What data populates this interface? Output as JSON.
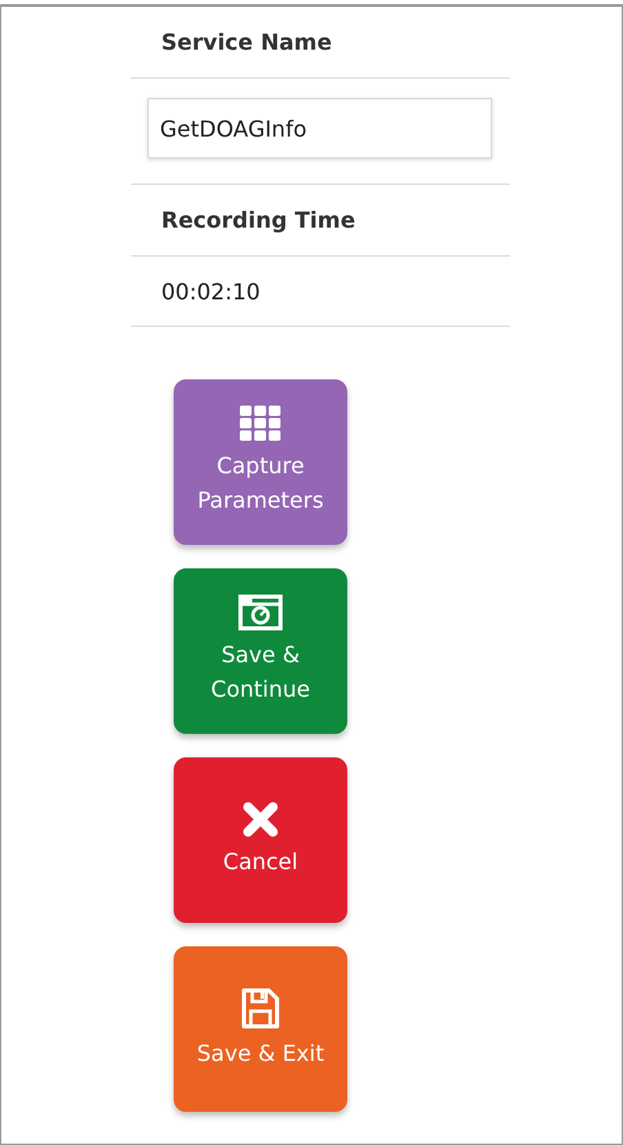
{
  "service_name": {
    "label": "Service Name",
    "value": "GetDOAGInfo"
  },
  "recording_time": {
    "label": "Recording Time",
    "value": "00:02:10"
  },
  "actions": [
    {
      "kind": "grid",
      "label": "Capture Parameters",
      "color": "#9466b4"
    },
    {
      "kind": "camera",
      "label": "Save & Continue",
      "color": "#0f8a3c"
    },
    {
      "kind": "close",
      "label": "Cancel",
      "color": "#e0202f"
    },
    {
      "kind": "save",
      "label": "Save & Exit",
      "color": "#ec6222"
    }
  ]
}
